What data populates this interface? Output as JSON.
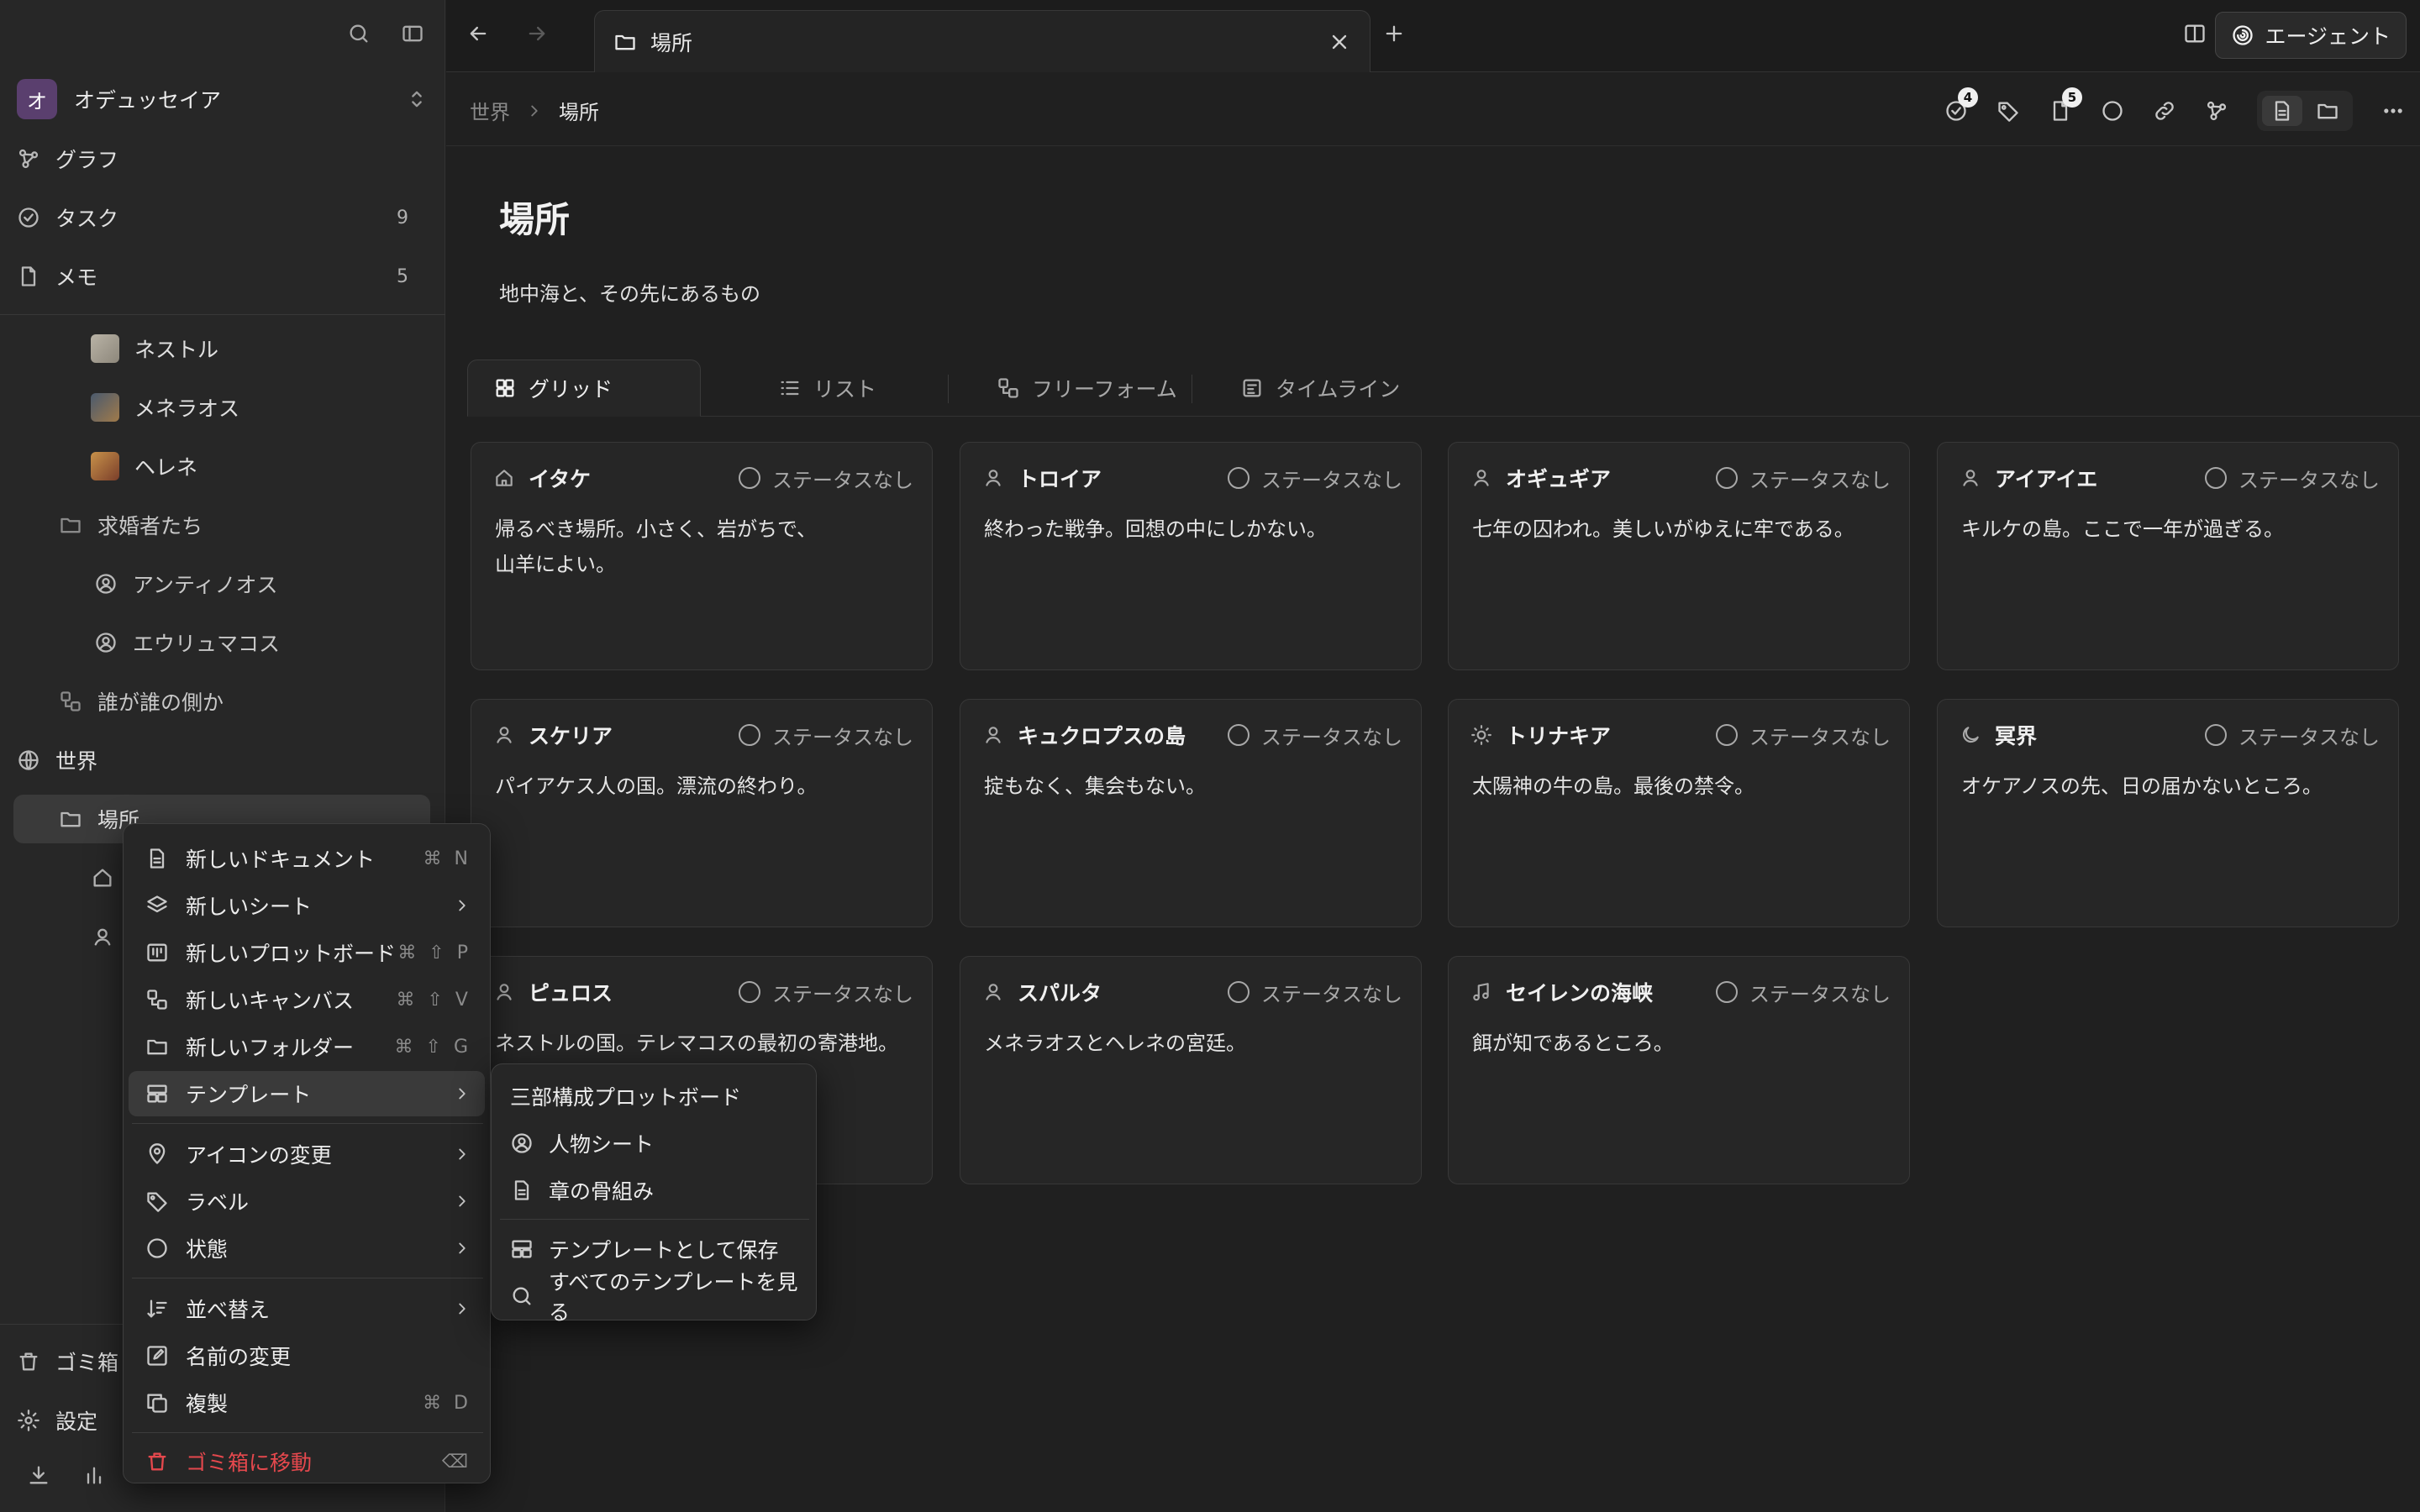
{
  "sidebar": {
    "workspace": {
      "initial": "オ",
      "name": "オデュッセイア"
    },
    "nav": [
      {
        "label": "グラフ",
        "icon": "graph-icon"
      },
      {
        "label": "タスク",
        "icon": "task-check-icon",
        "count": "9"
      },
      {
        "label": "メモ",
        "icon": "note-icon",
        "count": "5"
      }
    ],
    "tree": {
      "nestor": "ネストル",
      "menelaus": "メネラオス",
      "helen": "ヘレネ",
      "suitors": "求婚者たち",
      "antinous": "アンティノオス",
      "eurymachus": "エウリュマコス",
      "sides": "誰が誰の側か",
      "world": "世界",
      "places": "場所"
    },
    "footer": {
      "trash": "ゴミ箱",
      "settings": "設定"
    }
  },
  "tabbar": {
    "tab_title": "場所",
    "agent_label": "エージェント"
  },
  "breadcrumb": {
    "parent": "世界",
    "current": "場所"
  },
  "toolbar": {
    "tasks_badge": "4",
    "docs_badge": "5"
  },
  "page": {
    "title": "場所",
    "description": "地中海と、その先にあるもの"
  },
  "views": {
    "grid": "グリッド",
    "list": "リスト",
    "freeform": "フリーフォーム",
    "timeline": "タイムライン"
  },
  "status_none": "ステータスなし",
  "cards": [
    {
      "title": "イタケ",
      "icon": "home-icon",
      "body": "帰るべき場所。小さく、岩がちで、\n山羊によい。"
    },
    {
      "title": "トロイア",
      "icon": "person-pin-icon",
      "body": "終わった戦争。回想の中にしかない。"
    },
    {
      "title": "オギュギア",
      "icon": "person-pin-icon",
      "body": "七年の囚われ。美しいがゆえに牢である。"
    },
    {
      "title": "アイアイエ",
      "icon": "person-pin-icon",
      "body": "キルケの島。ここで一年が過ぎる。"
    },
    {
      "title": "スケリア",
      "icon": "person-pin-icon",
      "body": "パイアケス人の国。漂流の終わり。"
    },
    {
      "title": "キュクロプスの島",
      "icon": "person-pin-icon",
      "body": "掟もなく、集会もない。"
    },
    {
      "title": "トリナキア",
      "icon": "sun-icon",
      "body": "太陽神の牛の島。最後の禁令。"
    },
    {
      "title": "冥界",
      "icon": "moon-icon",
      "body": "オケアノスの先、日の届かないところ。"
    },
    {
      "title": "ピュロス",
      "icon": "person-pin-icon",
      "body": "ネストルの国。テレマコスの最初の寄港地。"
    },
    {
      "title": "スパルタ",
      "icon": "person-pin-icon",
      "body": "メネラオスとヘレネの宮廷。"
    },
    {
      "title": "セイレンの海峡",
      "icon": "music-note-icon",
      "body": "餌が知であるところ。"
    }
  ],
  "context_menu": {
    "new_document": "新しいドキュメント",
    "new_document_sc": "⌘ N",
    "new_sheet": "新しいシート",
    "new_plotboard": "新しいプロットボード",
    "new_plotboard_sc": "⌘ ⇧ P",
    "new_canvas": "新しいキャンバス",
    "new_canvas_sc": "⌘ ⇧ V",
    "new_folder": "新しいフォルダー",
    "new_folder_sc": "⌘ ⇧ G",
    "template": "テンプレート",
    "change_icon": "アイコンの変更",
    "label": "ラベル",
    "status": "状態",
    "sort": "並べ替え",
    "rename": "名前の変更",
    "duplicate": "複製",
    "duplicate_sc": "⌘ D",
    "move_to_trash": "ゴミ箱に移動",
    "move_to_trash_sc": "⌫"
  },
  "template_submenu": {
    "three_act": "三部構成プロットボード",
    "character_sheet": "人物シート",
    "chapter_outline": "章の骨組み",
    "save_as_template": "テンプレートとして保存",
    "view_all": "すべてのテンプレートを見る"
  },
  "colors": {
    "danger": "#e5484d",
    "workspace_avatar": "#5a3f6e"
  }
}
